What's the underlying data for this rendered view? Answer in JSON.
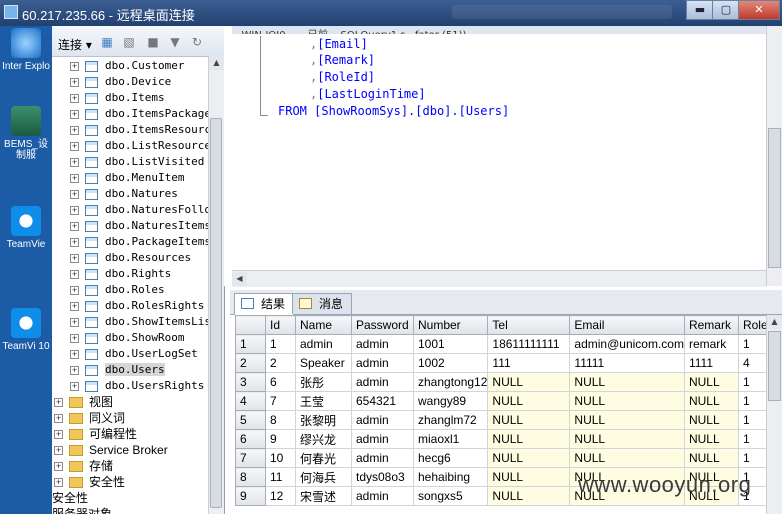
{
  "window": {
    "title": "60.217.235.66 - 远程桌面连接",
    "min_label": "▬",
    "restore_label": "▢",
    "close_label": "✕"
  },
  "desktop": {
    "icons": [
      {
        "label": "Inter Explo",
        "icon": "internet-explorer-icon"
      },
      {
        "label": "BEMS_设 制服",
        "icon": "bems-shortcut-icon"
      },
      {
        "label": "TeamVie",
        "icon": "teamviewer-icon"
      },
      {
        "label": "TeamVi 10",
        "icon": "teamviewer-icon"
      }
    ]
  },
  "explorer": {
    "connect_label": "连接 ▾",
    "tables": [
      "dbo.Customer",
      "dbo.Device",
      "dbo.Items",
      "dbo.ItemsPackage",
      "dbo.ItemsResource",
      "dbo.ListResources",
      "dbo.ListVisited",
      "dbo.MenuItem",
      "dbo.Natures",
      "dbo.NaturesFollow",
      "dbo.NaturesItemsS",
      "dbo.PackageItems",
      "dbo.Resources",
      "dbo.Rights",
      "dbo.Roles",
      "dbo.RolesRights",
      "dbo.ShowItemsList",
      "dbo.ShowRoom",
      "dbo.UserLogSet",
      "dbo.Users",
      "dbo.UsersRights"
    ],
    "selected": "dbo.Users",
    "folders": [
      "视图",
      "同义词",
      "可编程性",
      "Service Broker",
      "存储",
      "安全性"
    ],
    "root_items": [
      "安全性",
      "服务器对象"
    ]
  },
  "editor": {
    "tab_text": "...WIN-IQJ0...   ...已前...   SQLQuery1.s...fator (51))",
    "lines": [
      {
        "prefix": ",",
        "text": "[Email]"
      },
      {
        "prefix": ",",
        "text": "[Remark]"
      },
      {
        "prefix": ",",
        "text": "[RoleId]"
      },
      {
        "prefix": ",",
        "text": "[LastLoginTime]"
      }
    ],
    "from_kw": "FROM",
    "from_obj": "[ShowRoomSys].[dbo].[Users]"
  },
  "results": {
    "tab_results": "结果",
    "tab_messages": "消息",
    "columns": [
      "Id",
      "Name",
      "Password",
      "Number",
      "Tel",
      "Email",
      "Remark",
      "RoleI"
    ],
    "rows": [
      [
        "1",
        "1",
        "admin",
        "admin",
        "1001",
        "18611111111",
        "admin@unicom.com",
        "remark",
        "1"
      ],
      [
        "2",
        "2",
        "Speaker",
        "admin",
        "1002",
        "111",
        "11111",
        "1111",
        "4"
      ],
      [
        "3",
        "6",
        "张彤",
        "admin",
        "zhangtong12",
        "NULL",
        "NULL",
        "NULL",
        "1"
      ],
      [
        "4",
        "7",
        "王莹",
        "654321",
        "wangy89",
        "NULL",
        "NULL",
        "NULL",
        "1"
      ],
      [
        "5",
        "8",
        "张黎明",
        "admin",
        "zhanglm72",
        "NULL",
        "NULL",
        "NULL",
        "1"
      ],
      [
        "6",
        "9",
        "缪兴龙",
        "admin",
        "miaoxl1",
        "NULL",
        "NULL",
        "NULL",
        "1"
      ],
      [
        "7",
        "10",
        "何春光",
        "admin",
        "hecg6",
        "NULL",
        "NULL",
        "NULL",
        "1"
      ],
      [
        "8",
        "11",
        "何海兵",
        "tdys08o3",
        "hehaibing",
        "NULL",
        "NULL",
        "NULL",
        "1"
      ],
      [
        "9",
        "12",
        "宋雪述",
        "admin",
        "songxs5",
        "NULL",
        "NULL",
        "NULL",
        "1"
      ]
    ]
  },
  "watermark": "www.wooyun.org"
}
